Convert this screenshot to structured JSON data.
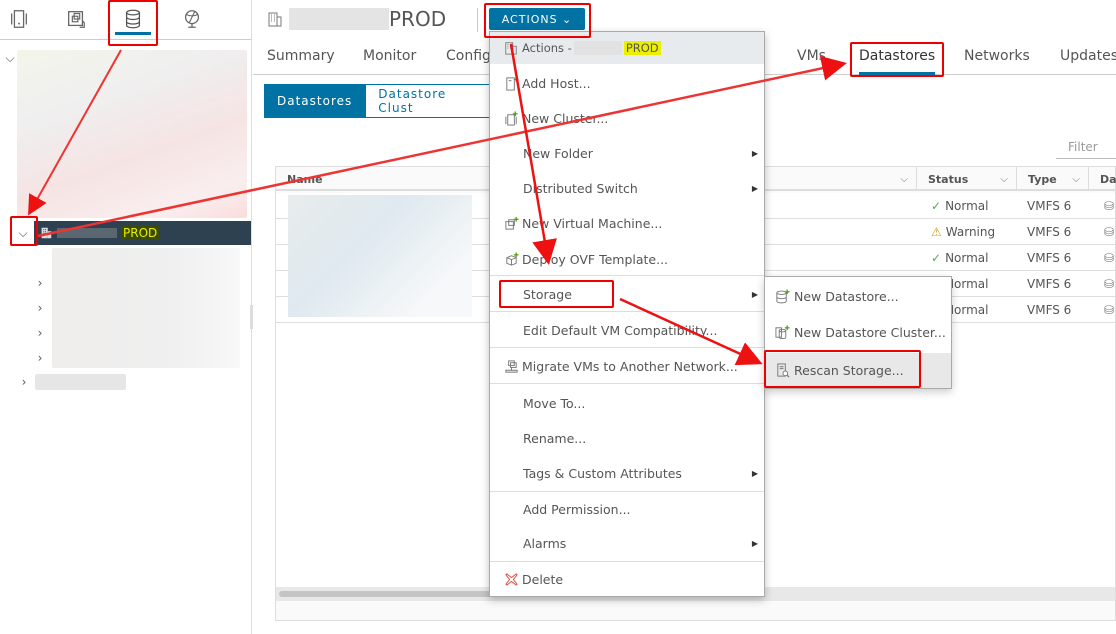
{
  "navigator": {
    "tabs": [
      {
        "name": "hosts-and-clusters",
        "icon": "hosts-clusters-icon"
      },
      {
        "name": "vms-and-templates",
        "icon": "vms-templates-icon"
      },
      {
        "name": "storage",
        "icon": "database-icon",
        "active": true
      },
      {
        "name": "networking",
        "icon": "network-globe-icon"
      }
    ],
    "tree": {
      "selected_label": "PROD",
      "children_count": 4
    }
  },
  "header": {
    "object_name": "PROD",
    "actions_label": "ACTIONS ⌄"
  },
  "tabs": [
    {
      "label": "Summary"
    },
    {
      "label": "Monitor"
    },
    {
      "label": "Config"
    },
    {
      "label": "VMs"
    },
    {
      "label": "Datastores",
      "active": true
    },
    {
      "label": "Networks"
    },
    {
      "label": "Updates"
    }
  ],
  "subtabs": [
    {
      "label": "Datastores",
      "active": true
    },
    {
      "label": "Datastore Clust"
    }
  ],
  "filter": {
    "placeholder": "Filter"
  },
  "grid": {
    "columns": [
      "Name",
      "Status",
      "Type",
      "Dat"
    ],
    "rows": [
      {
        "status": "Normal",
        "status_icon": "check-icon",
        "type": "VMFS 6"
      },
      {
        "status": "Warning",
        "status_icon": "warning-icon",
        "type": "VMFS 6"
      },
      {
        "status": "Normal",
        "status_icon": "check-icon",
        "type": "VMFS 6"
      },
      {
        "status": "Normal",
        "status_icon": "check-icon",
        "type": "VMFS 6"
      },
      {
        "status": "Normal",
        "status_icon": "check-icon",
        "type": "VMFS 6"
      }
    ]
  },
  "actions_menu": {
    "header_prefix": "Actions -",
    "header_object": "PROD",
    "items": [
      {
        "label": "Add Host...",
        "icon": "add-host-icon"
      },
      {
        "label": "New Cluster...",
        "icon": "new-cluster-icon"
      },
      {
        "label": "New Folder",
        "submenu": true
      },
      {
        "label": "Distributed Switch",
        "submenu": true
      },
      {
        "label": "New Virtual Machine...",
        "icon": "new-vm-icon"
      },
      {
        "label": "Deploy OVF Template...",
        "icon": "deploy-ovf-icon"
      },
      {
        "label": "Storage",
        "submenu": true
      },
      {
        "label": "Edit Default VM Compatibility..."
      },
      {
        "label": "Migrate VMs to Another Network...",
        "icon": "migrate-vms-icon"
      },
      {
        "label": "Move To..."
      },
      {
        "label": "Rename..."
      },
      {
        "label": "Tags & Custom Attributes",
        "submenu": true
      },
      {
        "label": "Add Permission..."
      },
      {
        "label": "Alarms",
        "submenu": true
      },
      {
        "label": "Delete",
        "icon": "delete-icon"
      }
    ]
  },
  "storage_submenu": {
    "items": [
      {
        "label": "New Datastore...",
        "icon": "new-datastore-icon"
      },
      {
        "label": "New Datastore Cluster...",
        "icon": "new-datastore-cluster-icon"
      },
      {
        "label": "Rescan Storage...",
        "icon": "rescan-storage-icon",
        "hovered": true
      }
    ]
  },
  "colors": {
    "accent": "#0072a3",
    "selected_tree_bg": "#2d4150",
    "annotation": "#ee0000",
    "ok": "#4caf50",
    "warning": "#c9a227",
    "delete": "#e04a3a"
  }
}
